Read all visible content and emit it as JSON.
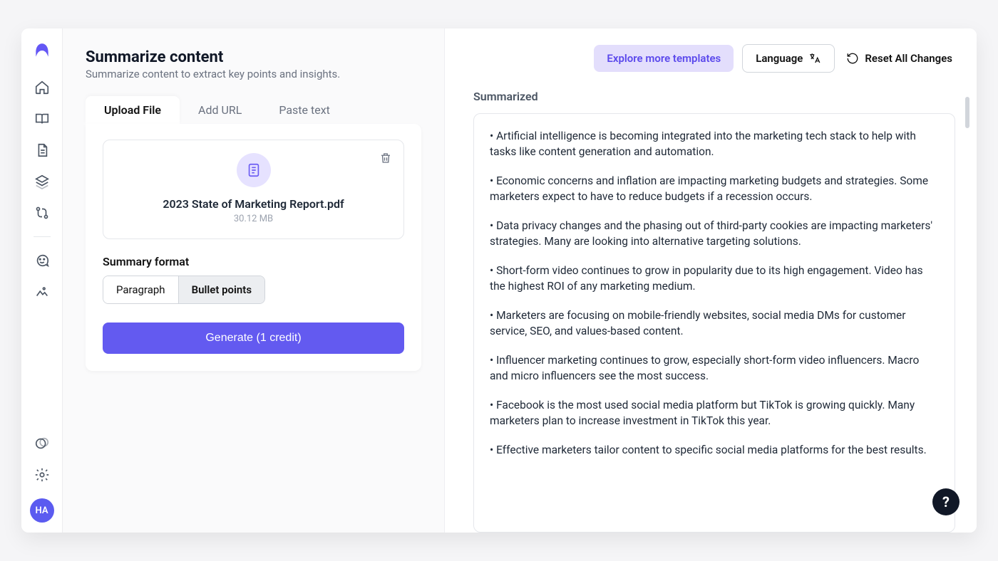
{
  "sidebar": {
    "avatar_initials": "HA"
  },
  "header": {
    "title": "Summarize content",
    "subtitle": "Summarize content to extract key points and insights."
  },
  "tabs": [
    {
      "label": "Upload File",
      "active": true
    },
    {
      "label": "Add URL",
      "active": false
    },
    {
      "label": "Paste text",
      "active": false
    }
  ],
  "file": {
    "name": "2023 State of Marketing Report.pdf",
    "size": "30.12 MB"
  },
  "format": {
    "label": "Summary format",
    "options": [
      "Paragraph",
      "Bullet points"
    ],
    "selected": "Bullet points"
  },
  "generate_label": "Generate (1 credit)",
  "actions": {
    "explore_label": "Explore more templates",
    "language_label": "Language",
    "reset_label": "Reset All Changes"
  },
  "result": {
    "title": "Summarized",
    "bullets": [
      "Artificial intelligence is becoming integrated into the marketing tech stack to help with tasks like content generation and automation.",
      "Economic concerns and inflation are impacting marketing budgets and strategies. Some marketers expect to have to reduce budgets if a recession occurs.",
      "Data privacy changes and the phasing out of third-party cookies are impacting marketers' strategies. Many are looking into alternative targeting solutions.",
      "Short-form video continues to grow in popularity due to its high engagement. Video has the highest ROI of any marketing medium.",
      "Marketers are focusing on mobile-friendly websites, social media DMs for customer service, SEO, and values-based content.",
      "Influencer marketing continues to grow, especially short-form video influencers. Macro and micro influencers see the most success.",
      "Facebook is the most used social media platform but TikTok is growing quickly. Many marketers plan to increase investment in TikTok this year.",
      "Effective marketers tailor content to specific social media platforms for the best results."
    ]
  },
  "help_label": "?"
}
